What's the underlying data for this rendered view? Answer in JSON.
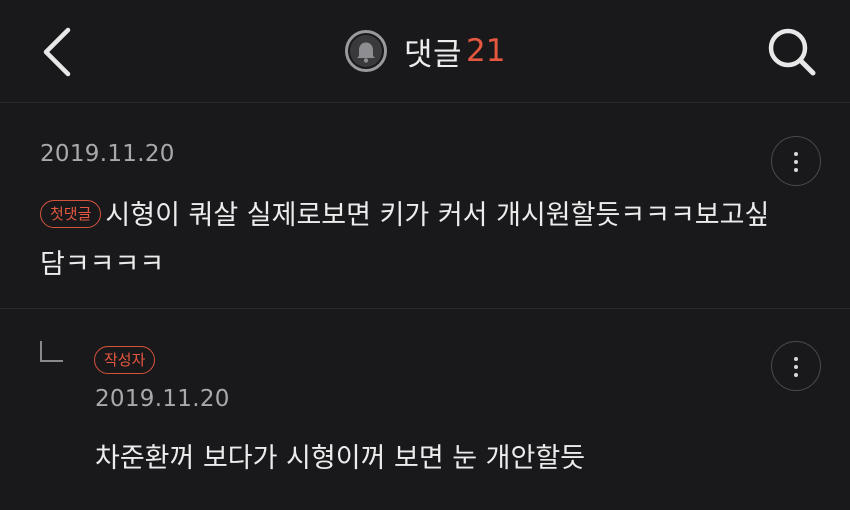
{
  "header": {
    "title": "댓글",
    "count": "21",
    "icons": {
      "back": "chevron-left-icon",
      "notify": "bell-icon",
      "search": "search-icon"
    }
  },
  "comments": [
    {
      "date": "2019.11.20",
      "badge": "첫댓글",
      "text": "시형이 쿼살 실제로보면 키가 커서 개시원할듯ㅋㅋㅋ보고싶담ㅋㅋㅋㅋ"
    },
    {
      "is_reply": true,
      "badge": "작성자",
      "date": "2019.11.20",
      "text": "차준환꺼 보다가 시형이꺼 보면 눈 개안할듯"
    }
  ],
  "colors": {
    "background": "#19191b",
    "accent": "#e5573f",
    "text": "#ececec",
    "muted": "#a9a9ad"
  }
}
